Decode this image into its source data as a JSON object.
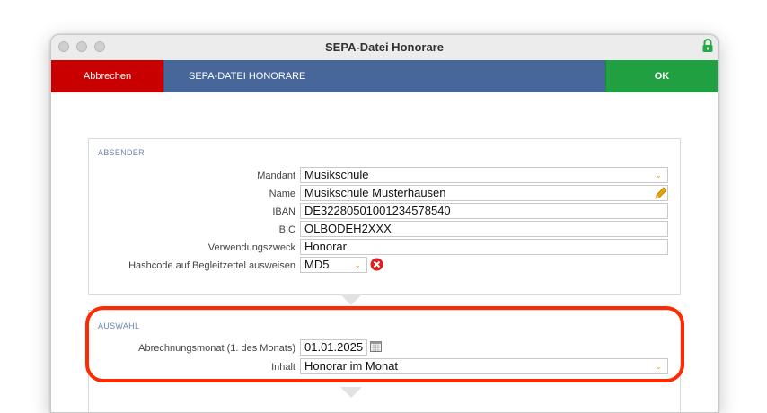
{
  "window": {
    "title": "SEPA-Datei Honorare"
  },
  "toolbar": {
    "cancel_label": "Abbrechen",
    "title": "SEPA-DATEI HONORARE",
    "ok_label": "OK"
  },
  "absender": {
    "title": "ABSENDER",
    "fields": {
      "mandant": {
        "label": "Mandant",
        "value": "Musikschule"
      },
      "name": {
        "label": "Name",
        "value": "Musikschule Musterhausen"
      },
      "iban": {
        "label": "IBAN",
        "value": "DE32280501001234578540"
      },
      "bic": {
        "label": "BIC",
        "value": "OLBODEH2XXX"
      },
      "verwendungszweck": {
        "label": "Verwendungszweck",
        "value": "Honorar"
      },
      "hashcode": {
        "label": "Hashcode auf Begleitzettel ausweisen",
        "value": "MD5"
      }
    }
  },
  "auswahl": {
    "title": "AUSWAHL",
    "fields": {
      "abrechnungsmonat": {
        "label": "Abrechnungsmonat (1. des Monats)",
        "value": "01.01.2025"
      },
      "inhalt": {
        "label": "Inhalt",
        "value": "Honorar im Monat"
      }
    }
  },
  "colors": {
    "cancel": "#c80000",
    "toolbar_title": "#47679a",
    "ok": "#20a040",
    "highlight": "#ff2a00",
    "section_title": "#6a86ad"
  },
  "icons": [
    "lock-icon",
    "chevron-down-icon",
    "pencil-icon",
    "clear-icon",
    "calendar-icon"
  ]
}
